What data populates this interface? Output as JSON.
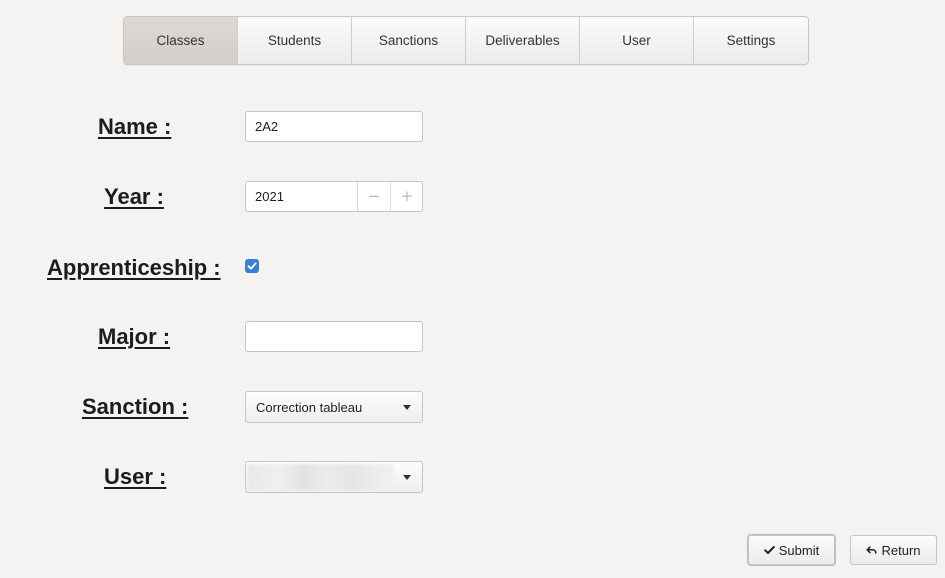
{
  "tabs": [
    {
      "label": "Classes",
      "active": true
    },
    {
      "label": "Students"
    },
    {
      "label": "Sanctions"
    },
    {
      "label": "Deliverables"
    },
    {
      "label": "User"
    },
    {
      "label": "Settings"
    }
  ],
  "form": {
    "name_label": "Name :",
    "name_value": "2A2",
    "year_label": "Year :",
    "year_value": "2021",
    "year_decrement": "−",
    "year_increment": "+",
    "apprenticeship_label": "Apprenticeship :",
    "apprenticeship_checked": true,
    "major_label": "Major :",
    "major_value": "",
    "sanction_label": "Sanction :",
    "sanction_selected": "Correction tableau",
    "user_label": "User :"
  },
  "buttons": {
    "submit_label": "Submit",
    "return_label": "Return"
  },
  "colors": {
    "checkbox_accent": "#3a7fd6"
  }
}
